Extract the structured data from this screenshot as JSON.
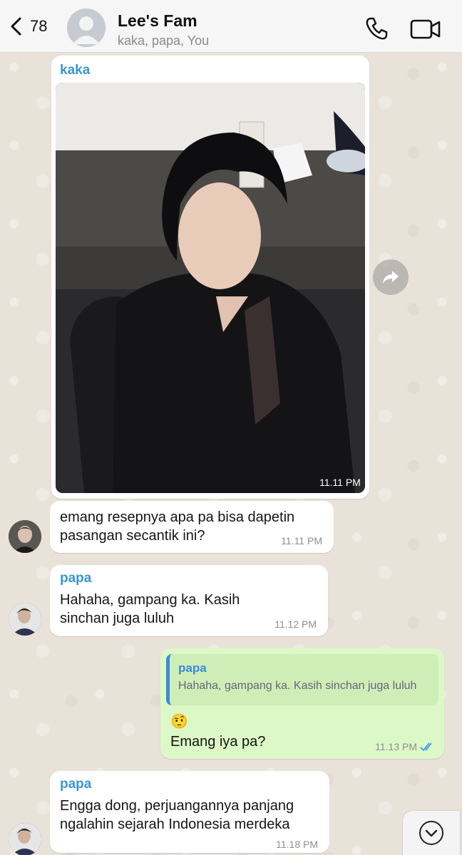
{
  "header": {
    "back_count": "78",
    "title": "Lee's Fam",
    "subtitle": "kaka, papa, You"
  },
  "messages": [
    {
      "sender": "kaka",
      "type": "photo",
      "time": "11.11 PM"
    },
    {
      "text": "emang resepnya apa pa bisa dapetin pasangan secantik ini?",
      "time": "11.11 PM"
    },
    {
      "sender": "papa",
      "text": "Hahaha, gampang ka. Kasih sinchan juga luluh",
      "time": "11.12 PM"
    },
    {
      "reply_to_sender": "papa",
      "reply_to_text": "Hahaha, gampang ka. Kasih sinchan juga luluh",
      "emoji": "🤨",
      "text": "Emang iya pa?",
      "time": "11.13 PM",
      "status": "read"
    },
    {
      "sender": "papa",
      "text": "Engga dong, perjuangannya panjang ngalahin sejarah Indonesia merdeka",
      "time": "11.18 PM"
    }
  ],
  "colors": {
    "sender_name": "#3a97d3",
    "outgoing_bubble": "#dcf8c6",
    "read_ticks": "#4fa3e0"
  }
}
